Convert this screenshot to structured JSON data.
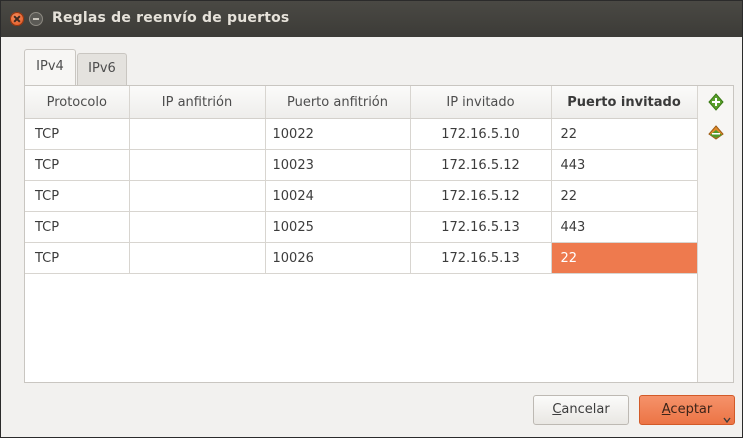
{
  "window": {
    "title": "Reglas de reenvío de puertos"
  },
  "tabs": [
    {
      "label": "IPv4",
      "active": true
    },
    {
      "label": "IPv6",
      "active": false
    }
  ],
  "table": {
    "columns": [
      "Protocolo",
      "IP anfitrión",
      "Puerto anfitrión",
      "IP invitado",
      "Puerto invitado"
    ],
    "rows": [
      {
        "protocol": "TCP",
        "host_ip": "",
        "host_port": "10022",
        "guest_ip": "172.16.5.10",
        "guest_port": "22"
      },
      {
        "protocol": "TCP",
        "host_ip": "",
        "host_port": "10023",
        "guest_ip": "172.16.5.12",
        "guest_port": "443"
      },
      {
        "protocol": "TCP",
        "host_ip": "",
        "host_port": "10024",
        "guest_ip": "172.16.5.12",
        "guest_port": "22"
      },
      {
        "protocol": "TCP",
        "host_ip": "",
        "host_port": "10025",
        "guest_ip": "172.16.5.13",
        "guest_port": "443"
      },
      {
        "protocol": "TCP",
        "host_ip": "",
        "host_port": "10026",
        "guest_ip": "172.16.5.13",
        "guest_port": "22"
      }
    ],
    "selected_cell": {
      "row": 4,
      "column": "Puerto invitado"
    }
  },
  "side_icons": [
    "add-rule-icon",
    "edit-rule-icon"
  ],
  "buttons": {
    "cancel_first": "C",
    "cancel_rest": "ancelar",
    "accept_first": "A",
    "accept_rest": "ceptar"
  },
  "colors": {
    "accent": "#ee7a4e",
    "titlebar": "#3c3b37",
    "close_button": "#e0521d"
  }
}
